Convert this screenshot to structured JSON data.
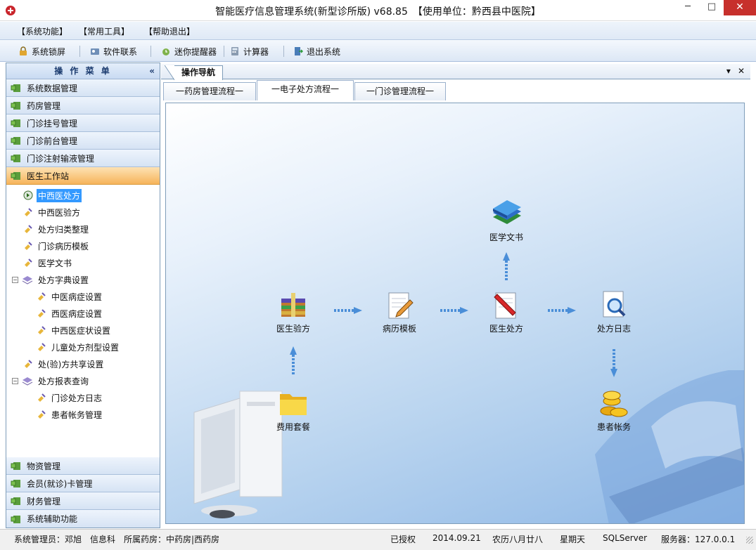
{
  "window": {
    "title": "智能医疗信息管理系统(新型诊所版) v68.85　【使用单位：黔西县中医院】",
    "min": "─",
    "max": "□",
    "close": "✕"
  },
  "menubar": [
    {
      "label": "【系统功能】"
    },
    {
      "label": "【常用工具】"
    },
    {
      "label": "【帮助退出】"
    }
  ],
  "toolbar": [
    {
      "label": "系统锁屏",
      "icon": "lock-icon"
    },
    {
      "label": "软件联系",
      "icon": "contact-icon"
    },
    {
      "label": "迷你提醒器",
      "icon": "reminder-icon"
    },
    {
      "label": "计算器",
      "icon": "calculator-icon"
    },
    {
      "label": "退出系统",
      "icon": "exit-icon"
    }
  ],
  "sidebar": {
    "title": "操 作 菜 单",
    "collapse": "«",
    "categories_top": [
      {
        "label": "系统数据管理"
      },
      {
        "label": "药房管理"
      },
      {
        "label": "门诊挂号管理"
      },
      {
        "label": "门诊前台管理"
      },
      {
        "label": "门诊注射输液管理"
      },
      {
        "label": "医生工作站"
      }
    ],
    "tree": [
      {
        "label": "中西医处方"
      },
      {
        "label": "中西医验方"
      },
      {
        "label": "处方归类整理"
      },
      {
        "label": "门诊病历模板"
      },
      {
        "label": "医学文书"
      },
      {
        "label": "处方字典设置"
      },
      {
        "label": "中医病症设置"
      },
      {
        "label": "西医病症设置"
      },
      {
        "label": "中西医症状设置"
      },
      {
        "label": "儿童处方剂型设置"
      },
      {
        "label": "处(验)方共享设置"
      },
      {
        "label": "处方报表查询"
      },
      {
        "label": "门诊处方日志"
      },
      {
        "label": "患者帐务管理"
      }
    ],
    "expander_minus": "⊟",
    "categories_bottom": [
      {
        "label": "物资管理"
      },
      {
        "label": "会员(就诊)卡管理"
      },
      {
        "label": "财务管理"
      },
      {
        "label": "系统辅助功能"
      }
    ]
  },
  "main": {
    "doc_tab": "操作导航",
    "tab_menu": "▾",
    "tab_close": "✕",
    "flow_tabs": [
      {
        "label": "一药房管理流程一"
      },
      {
        "label": "一电子处方流程一"
      },
      {
        "label": "一门诊管理流程一"
      }
    ],
    "nodes": {
      "yixue_wenshu": "医学文书",
      "yisheng_yanfang": "医生验方",
      "bingli_muban": "病历模板",
      "yisheng_chufang": "医生处方",
      "chufang_rizhi": "处方日志",
      "feiyong_taocan": "费用套餐",
      "huanzhe_zhangwu": "患者帐务"
    }
  },
  "status": {
    "admin": "系统管理员：邓旭",
    "dept": "信息科",
    "pharmacy": "所属药房：中药房|西药房",
    "licensed": "已授权",
    "date": "2014.09.21",
    "lunar": "农历八月廿八",
    "weekday": "星期天",
    "db": "SQLServer",
    "server": "服务器：127.0.0.1"
  },
  "colors": {
    "accent": "#3399ff",
    "active_category": "#f6b45a",
    "close_button": "#c7302c"
  }
}
